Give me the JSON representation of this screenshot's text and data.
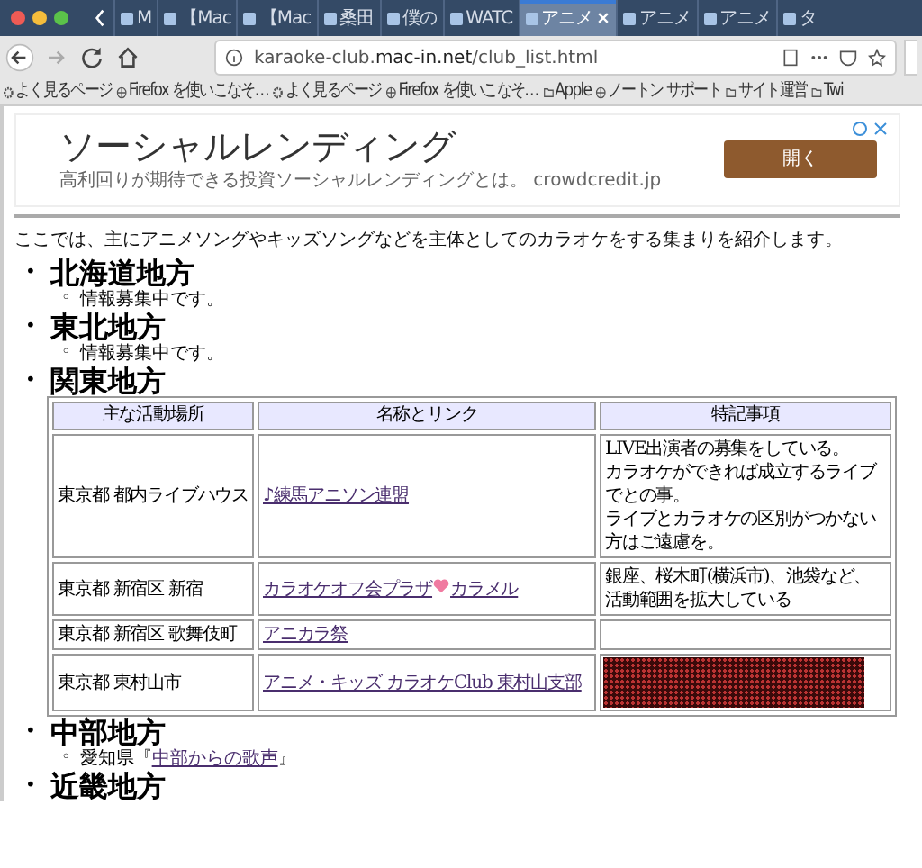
{
  "browser": {
    "tabs": [
      {
        "title": "M",
        "selected": false
      },
      {
        "title": "【Mac",
        "selected": false
      },
      {
        "title": "【Mac",
        "selected": false
      },
      {
        "title": "桑田",
        "selected": false
      },
      {
        "title": "僕の",
        "selected": false
      },
      {
        "title": "WATC",
        "selected": false
      },
      {
        "title": "アニメ",
        "selected": true
      },
      {
        "title": "アニメ",
        "selected": false
      },
      {
        "title": "アニメ",
        "selected": false
      },
      {
        "title": "タ",
        "selected": false
      }
    ],
    "url": {
      "host_pre": "karaoke-club.",
      "host": "mac-in.net",
      "path": "/club_list.html"
    },
    "bookmarks": [
      {
        "kind": "gear",
        "label": "よく見るページ"
      },
      {
        "kind": "globe",
        "label": "Firefox を使いこなそ…"
      },
      {
        "kind": "gear",
        "label": "よく見るページ"
      },
      {
        "kind": "globe",
        "label": "Firefox を使いこなそ…"
      },
      {
        "kind": "folder",
        "label": "Apple"
      },
      {
        "kind": "globe",
        "label": "ノートン サポート"
      },
      {
        "kind": "folder",
        "label": "サイト運営"
      },
      {
        "kind": "folder",
        "label": "Twi"
      }
    ]
  },
  "ad": {
    "title": "ソーシャルレンディング",
    "subtitle": "高利回りが期待できる投資ソーシャルレンディングとは。 crowdcredit.jp",
    "button": "開く"
  },
  "intro": "ここでは、主にアニメソングやキッズソングなどを主体としてのカラオケをする集まりを紹介します。",
  "regions": [
    {
      "marker": "•",
      "name": "北海道地方",
      "items": [
        {
          "marker": "◦",
          "text": "情報募集中です。"
        }
      ]
    },
    {
      "marker": "•",
      "name": "東北地方",
      "items": [
        {
          "marker": "◦",
          "text": "情報募集中です。"
        }
      ]
    },
    {
      "marker": "•",
      "name": "関東地方",
      "table": {
        "columns": [
          "主な活動場所",
          "名称とリンク",
          "特記事項"
        ],
        "rows": [
          {
            "place": "東京都 都内ライブハウス",
            "link_parts": [
              "♪練馬アニソン連盟"
            ],
            "kind": "text",
            "notes": [
              "LIVE出演者の募集をしている。",
              "カラオケができれば成立するライブでとの事。",
              "ライブとカラオケの区別がつかない方はご遠慮を。"
            ]
          },
          {
            "place": "東京都 新宿区 新宿",
            "link_parts": [
              "カラオケオフ会プラザ",
              "カラメル"
            ],
            "kind": "text",
            "notes": [
              "銀座、桜木町(横浜市)、池袋など、活動範囲を拡大している"
            ]
          },
          {
            "place": "東京都 新宿区 歌舞伎町",
            "link_parts": [
              "アニカラ祭"
            ],
            "kind": "empty"
          },
          {
            "place": "東京都 東村山市",
            "link_parts": [
              "アニメ・キッズ カラオケClub 東村山支部"
            ],
            "kind": "banner"
          }
        ]
      }
    },
    {
      "marker": "•",
      "name": "中部地方",
      "items": [
        {
          "marker": "◦",
          "text": "愛知県『",
          "link": "中部からの歌声",
          "after": "』"
        }
      ]
    },
    {
      "marker": "•",
      "name": "近畿地方"
    }
  ]
}
